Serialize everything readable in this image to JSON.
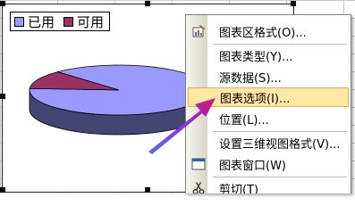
{
  "legend": [
    {
      "label": "已用",
      "color": "#9999ff"
    },
    {
      "label": "可用",
      "color": "#993366"
    }
  ],
  "chart_data": {
    "type": "pie",
    "categories": [
      "已用",
      "可用"
    ],
    "values": [
      88,
      12
    ],
    "colors": [
      "#9999ff",
      "#993366"
    ],
    "three_d": true,
    "legend_position": "top-left"
  },
  "context_menu": {
    "items": [
      {
        "label": "图表区格式(O)...",
        "icon": "format-chart-area-icon"
      },
      {
        "label": "图表类型(Y)..."
      },
      {
        "label": "源数据(S)..."
      },
      {
        "label": "图表选项(I)...",
        "highlighted": true
      },
      {
        "label": "位置(L)..."
      },
      {
        "label": "设置三维视图格式(V)..."
      },
      {
        "label": "图表窗口(W)",
        "icon": "chart-window-icon"
      },
      {
        "label": "剪切(T)",
        "icon": "scissors-icon"
      }
    ]
  },
  "colors": {
    "highlight_bg": "#ffe8a6",
    "highlight_border": "#e7b24b",
    "arrow": "#7a34d8"
  }
}
